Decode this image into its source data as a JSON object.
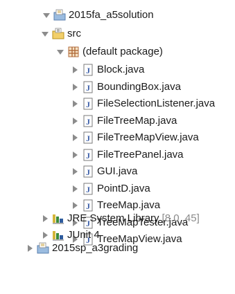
{
  "tree": {
    "project_1": {
      "label": "2015fa_a5solution"
    },
    "src": {
      "label": "src"
    },
    "package": {
      "label": "(default package)"
    },
    "files": [
      {
        "label": "Block.java"
      },
      {
        "label": "BoundingBox.java"
      },
      {
        "label": "FileSelectionListener.java"
      },
      {
        "label": "FileTreeMap.java"
      },
      {
        "label": "FileTreeMapView.java"
      },
      {
        "label": "FileTreePanel.java"
      },
      {
        "label": "GUI.java"
      },
      {
        "label": "PointD.java"
      },
      {
        "label": "TreeMap.java"
      },
      {
        "label": "TreeMapTester.java"
      },
      {
        "label": "TreeMapView.java"
      }
    ],
    "jre": {
      "label": "JRE System Library",
      "suffix": "[8.0_45]"
    },
    "junit": {
      "label": "JUnit 4"
    },
    "project_2": {
      "label": "2015sp_a3grading"
    }
  }
}
